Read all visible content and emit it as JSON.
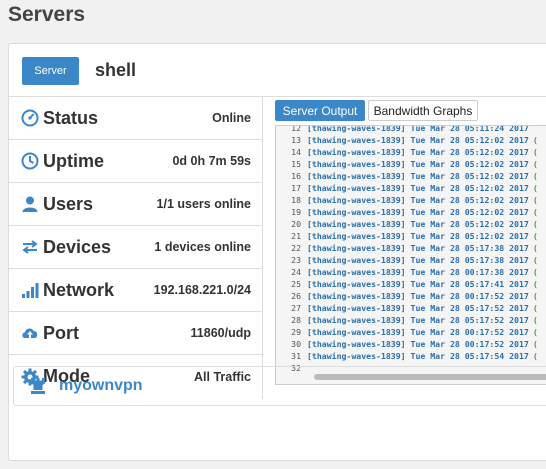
{
  "page": {
    "title": "Servers"
  },
  "header": {
    "server_button": "Server",
    "server_name": "shell"
  },
  "stats": [
    {
      "label": "Status",
      "value": "Online",
      "icon": "gauge-icon"
    },
    {
      "label": "Uptime",
      "value": "0d 0h 7m 59s",
      "icon": "clock-icon"
    },
    {
      "label": "Users",
      "value": "1/1 users online",
      "icon": "user-icon"
    },
    {
      "label": "Devices",
      "value": "1 devices online",
      "icon": "arrows-icon"
    },
    {
      "label": "Network",
      "value": "192.168.221.0/24",
      "icon": "signal-icon"
    },
    {
      "label": "Port",
      "value": "11860/udp",
      "icon": "cloud-upload-icon"
    },
    {
      "label": "Mode",
      "value": "All Traffic",
      "icon": "gear-icon"
    }
  ],
  "tabs": {
    "active": "Server Output",
    "inactive": "Bandwidth Graphs"
  },
  "console": {
    "lines": [
      {
        "n": "12",
        "text": "[thawing-waves-1839] Tue Mar 28 05:11:24 2017",
        "ok": ""
      },
      {
        "n": "13",
        "text": "[thawing-waves-1839] Tue Mar 28 05:12:02 2017",
        "ok": "("
      },
      {
        "n": "14",
        "text": "[thawing-waves-1839] Tue Mar 28 05:12:02 2017",
        "ok": "("
      },
      {
        "n": "15",
        "text": "[thawing-waves-1839] Tue Mar 28 05:12:02 2017",
        "ok": "("
      },
      {
        "n": "16",
        "text": "[thawing-waves-1839] Tue Mar 28 05:12:02 2017",
        "ok": "("
      },
      {
        "n": "17",
        "text": "[thawing-waves-1839] Tue Mar 28 05:12:02 2017",
        "ok": "("
      },
      {
        "n": "18",
        "text": "[thawing-waves-1839] Tue Mar 28 05:12:02 2017",
        "ok": "("
      },
      {
        "n": "19",
        "text": "[thawing-waves-1839] Tue Mar 28 05:12:02 2017",
        "ok": "("
      },
      {
        "n": "20",
        "text": "[thawing-waves-1839] Tue Mar 28 05:12:02 2017",
        "ok": "("
      },
      {
        "n": "21",
        "text": "[thawing-waves-1839] Tue Mar 28 05:12:02 2017",
        "ok": "("
      },
      {
        "n": "22",
        "text": "[thawing-waves-1839] Tue Mar 28 05:17:38 2017",
        "ok": "("
      },
      {
        "n": "23",
        "text": "[thawing-waves-1839] Tue Mar 28 05:17:38 2017",
        "ok": "("
      },
      {
        "n": "24",
        "text": "[thawing-waves-1839] Tue Mar 28 00:17:38 2017",
        "ok": "("
      },
      {
        "n": "25",
        "text": "[thawing-waves-1839] Tue Mar 28 05:17:41 2017",
        "ok": "("
      },
      {
        "n": "26",
        "text": "[thawing-waves-1839] Tue Mar 28 00:17:52 2017",
        "ok": "("
      },
      {
        "n": "27",
        "text": "[thawing-waves-1839] Tue Mar 28 05:17:52 2017",
        "ok": "("
      },
      {
        "n": "28",
        "text": "[thawing-waves-1839] Tue Mar 28 05:17:52 2017",
        "ok": "("
      },
      {
        "n": "29",
        "text": "[thawing-waves-1839] Tue Mar 28 00:17:52 2017",
        "ok": "("
      },
      {
        "n": "30",
        "text": "[thawing-waves-1839] Tue Mar 28 00:17:52 2017",
        "ok": "("
      },
      {
        "n": "31",
        "text": "[thawing-waves-1839] Tue Mar 28 05:17:54 2017",
        "ok": "("
      },
      {
        "n": "32",
        "text": "",
        "ok": ""
      }
    ]
  },
  "footer": {
    "network_name": "myownvpn",
    "icon": "rook-icon"
  },
  "colors": {
    "accent": "#3b87c8",
    "console_text": "#2a6fb0",
    "ok_text": "#4c9a2a"
  }
}
